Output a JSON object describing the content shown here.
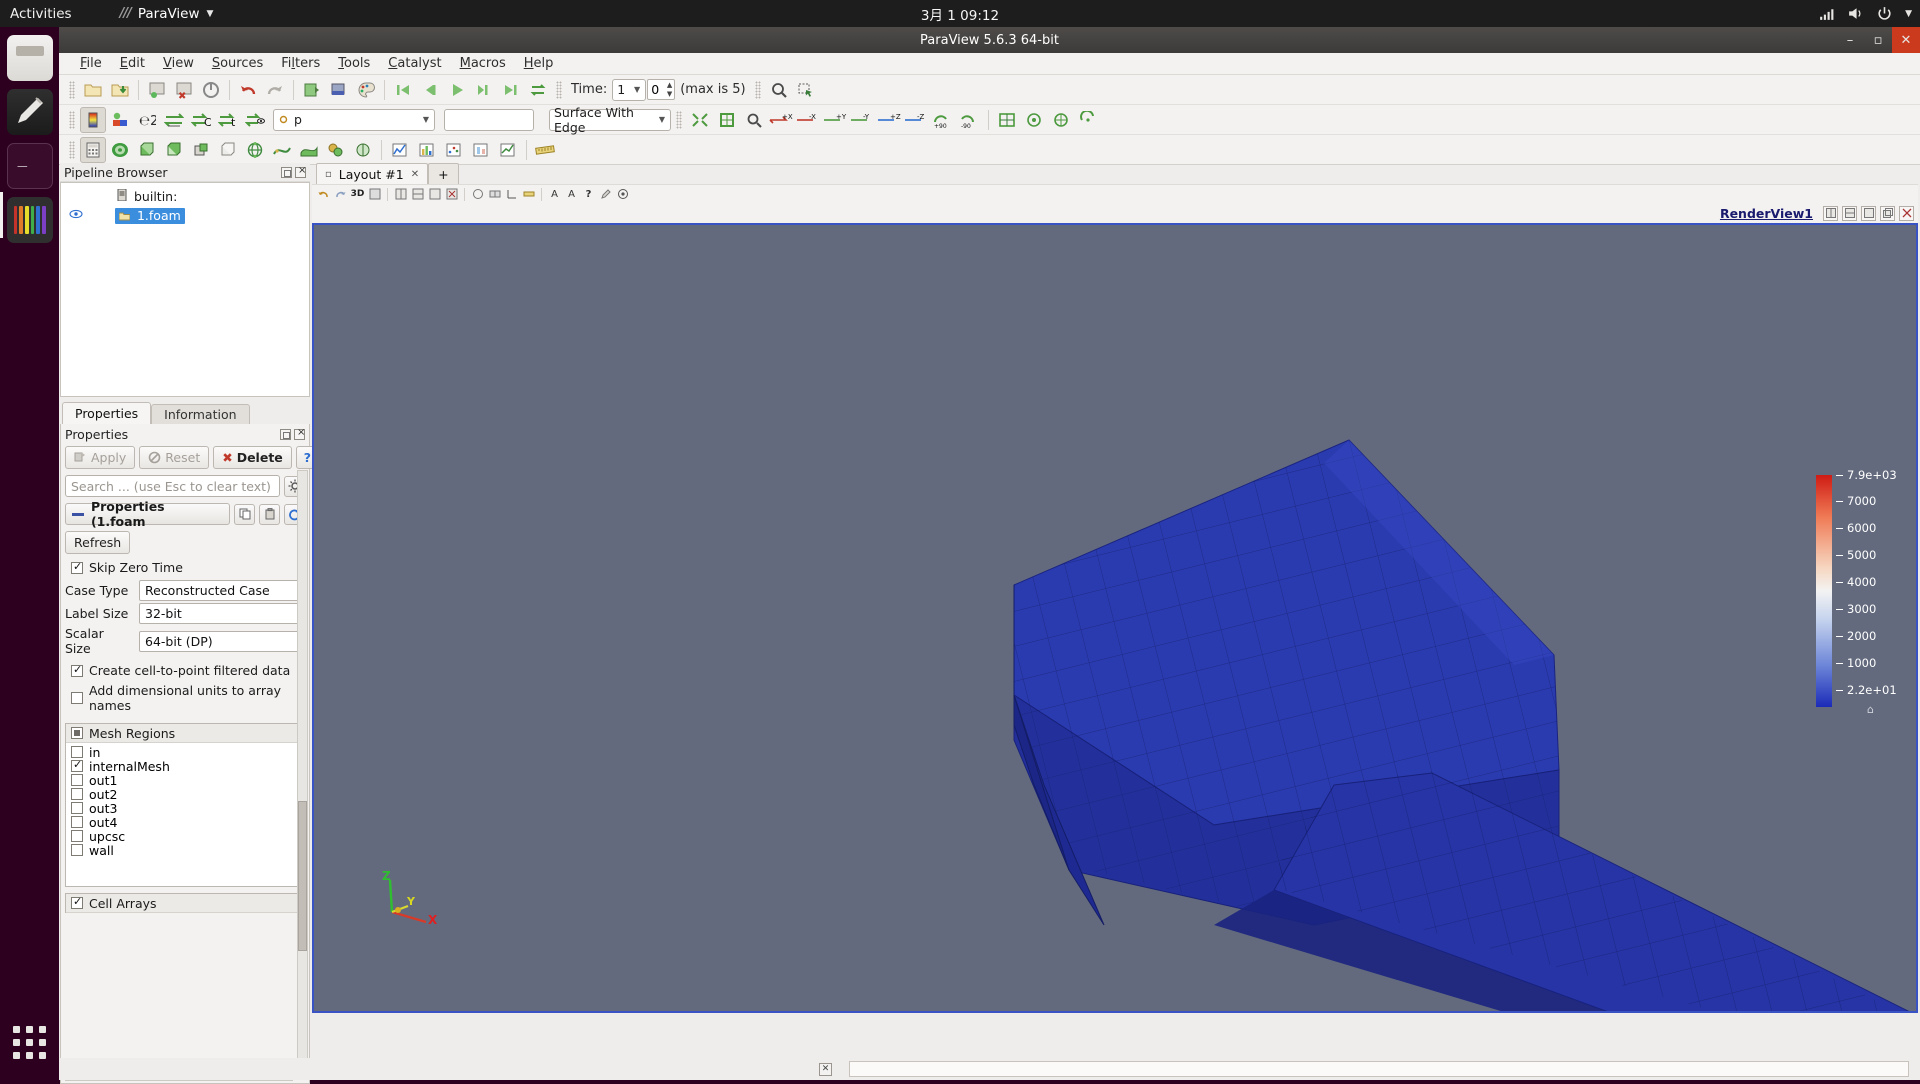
{
  "desktop": {
    "activities": "Activities",
    "app_menu": "ParaView",
    "clock": "3月 1  09:12",
    "indicators": [
      "network-icon",
      "volume-icon",
      "power-icon",
      "chevron-down-icon"
    ],
    "launcher": [
      {
        "name": "files",
        "label": "Files"
      },
      {
        "name": "writer",
        "label": "Text Editor"
      },
      {
        "name": "terminal",
        "label": "Terminal"
      },
      {
        "name": "paraview",
        "label": "ParaView"
      },
      {
        "name": "show-applications",
        "label": "Show Applications"
      }
    ]
  },
  "window": {
    "title": "ParaView 5.6.3 64-bit",
    "minimize": "–",
    "maximize": "▫",
    "close": "✕"
  },
  "menubar": [
    {
      "label": "File",
      "accel": "F"
    },
    {
      "label": "Edit",
      "accel": "E"
    },
    {
      "label": "View",
      "accel": "V"
    },
    {
      "label": "Sources",
      "accel": "S"
    },
    {
      "label": "Filters",
      "accel": "l"
    },
    {
      "label": "Tools",
      "accel": "T"
    },
    {
      "label": "Catalyst",
      "accel": "C"
    },
    {
      "label": "Macros",
      "accel": "M"
    },
    {
      "label": "Help",
      "accel": "H"
    }
  ],
  "main_toolbar": {
    "buttons": [
      "open-file-icon",
      "open-recent-icon",
      "save-data-icon",
      "save-state-icon",
      "reset-session-icon",
      "undo-icon",
      "redo-icon",
      "connect-server-icon",
      "disconnect-server-icon",
      "color-palette-icon"
    ],
    "vcr": [
      "first-frame-icon",
      "previous-frame-icon",
      "play-icon",
      "next-frame-icon",
      "last-frame-icon",
      "loop-icon"
    ],
    "time_label": "Time:",
    "time_value": "1",
    "frame_value": "0",
    "max_label": "(max is 5)",
    "after_vcr": [
      "zoom-to-data-icon",
      "select-icon"
    ]
  },
  "repr_toolbar": {
    "buttons": [
      "color-map-editor-icon",
      "rescale-to-data-range-icon",
      "rescale-custom-icon",
      "rescale-over-time-icon",
      "rescale-visible-icon",
      "edit-color-legend-icon",
      "toggle-color-legend-icon"
    ],
    "array_combo": "p",
    "component_combo": "",
    "representation_combo": "Surface With Edge",
    "camera_buttons": [
      "reset-camera-icon",
      "zoom-to-box-icon",
      "zoom-to-data-icon",
      "plus-x-icon",
      "minus-x-icon",
      "plus-y-icon",
      "minus-y-icon",
      "plus-z-icon",
      "minus-z-icon",
      "rotate-plus90-icon",
      "rotate-minus90-icon",
      "center-axes-icon",
      "reset-center-icon",
      "pick-center-icon",
      "show-center-icon"
    ]
  },
  "source_toolbar": {
    "buttons": [
      "calculator-icon",
      "contour-icon",
      "clip-icon",
      "slice-icon",
      "threshold-icon",
      "extract-subset-icon",
      "glyph-icon",
      "stream-tracer-icon",
      "warp-icon",
      "group-datasets-icon",
      "extract-level-icon",
      "plot-over-line-icon",
      "histogram-icon",
      "scatter-plot-icon",
      "quartile-chart-icon",
      "bar-chart-icon",
      "ruler-icon"
    ]
  },
  "pipeline": {
    "title": "Pipeline Browser",
    "items": [
      {
        "label": "builtin:",
        "icon": "server-icon",
        "selected": false,
        "eye": false,
        "indent": 0
      },
      {
        "label": "1.foam",
        "icon": "reader-icon",
        "selected": true,
        "eye": true,
        "indent": 1
      }
    ]
  },
  "panel_tabs": [
    {
      "label": "Properties",
      "selected": true
    },
    {
      "label": "Information",
      "selected": false
    }
  ],
  "properties": {
    "title": "Properties",
    "apply_label": "Apply",
    "reset_label": "Reset",
    "delete_label": "Delete",
    "help_label": "?",
    "search_placeholder": "Search ... (use Esc to clear text)",
    "gear_icon": "gear-icon",
    "group_label": "Properties (1.foam",
    "group_buttons": [
      "copy-icon",
      "paste-icon",
      "restore-defaults-icon"
    ],
    "refresh_label": "Refresh",
    "skip_zero_time": {
      "label": "Skip Zero Time",
      "checked": true
    },
    "fields": [
      {
        "name": "Case Type",
        "value": "Reconstructed Case"
      },
      {
        "name": "Label Size",
        "value": "32-bit"
      },
      {
        "name": "Scalar Size",
        "value": "64-bit (DP)"
      }
    ],
    "checkboxes": [
      {
        "label": "Create cell-to-point filtered data",
        "checked": true
      },
      {
        "label": "Add dimensional units to array names",
        "checked": false
      }
    ],
    "mesh_regions": {
      "header": "Mesh Regions",
      "header_state": "partial",
      "items": [
        {
          "label": "in",
          "checked": false
        },
        {
          "label": "internalMesh",
          "checked": true
        },
        {
          "label": "out1",
          "checked": false
        },
        {
          "label": "out2",
          "checked": false
        },
        {
          "label": "out3",
          "checked": false
        },
        {
          "label": "out4",
          "checked": false
        },
        {
          "label": "upcsc",
          "checked": false
        },
        {
          "label": "wall",
          "checked": false
        }
      ]
    },
    "cell_arrays": {
      "header": "Cell Arrays",
      "header_state": "checked"
    }
  },
  "layout": {
    "tab_label": "Layout #1",
    "tab_close": "✕",
    "add_tab": "+",
    "view_toolbar_icons": [
      "camera-undo-icon",
      "camera-redo-icon",
      "3d-label",
      "render-icon",
      "split-horizontal-icon",
      "split-vertical-icon",
      "maximize-icon",
      "close-view-icon",
      "interaction-icon",
      "camera-link-icon",
      "axes-icon",
      "ruler-icon",
      "text-icon",
      "annotate-icon",
      "help-icon",
      "edit-icon",
      "capture-icon"
    ],
    "view_label": "3D",
    "view_name": "RenderView1",
    "view_buttons": [
      "split-horizontal-icon",
      "split-vertical-icon",
      "maximize-icon",
      "undock-icon",
      "close-icon"
    ]
  },
  "scalar_bar": {
    "title": "",
    "labels": [
      "7.9e+03",
      "7000",
      "6000",
      "5000",
      "4000",
      "3000",
      "2000",
      "1000",
      "2.2e+01"
    ],
    "top_color": "#d81f16",
    "mid_color": "#f3f3f3",
    "bottom_color": "#1f2fc4",
    "range_min": "2.2e+01",
    "range_max": "7.9e+03"
  },
  "axes_triad": {
    "x_label": "X",
    "y_label": "Y",
    "z_label": "Z",
    "x_color": "#e02020",
    "y_color": "#d8d820",
    "z_color": "#20c020"
  },
  "render_scene": {
    "background_color": "#636a7d",
    "mesh_color": "#2233a8",
    "edge_color": "#121a5c",
    "border_color": "#3a53c4"
  },
  "statusbar": {
    "close_icon": "✕",
    "message": ""
  }
}
